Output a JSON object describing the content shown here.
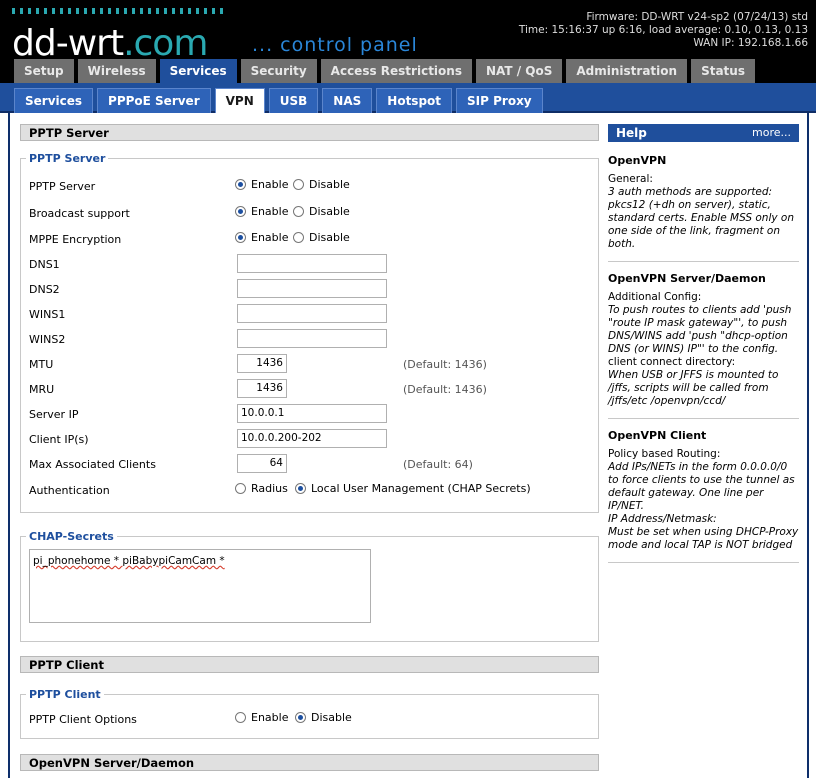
{
  "header": {
    "logo_text": "dd-wrt",
    "logo_suffix": ".com",
    "logo_sub": "... control panel",
    "firmware": "Firmware: DD-WRT v24-sp2 (07/24/13) std",
    "time": "Time: 15:16:37 up 6:16, load average: 0.10, 0.13, 0.13",
    "wan_ip": "WAN IP: 192.168.1.66"
  },
  "main_tabs": [
    "Setup",
    "Wireless",
    "Services",
    "Security",
    "Access Restrictions",
    "NAT / QoS",
    "Administration",
    "Status"
  ],
  "main_tab_active": "Services",
  "sub_tabs": [
    "Services",
    "PPPoE Server",
    "VPN",
    "USB",
    "NAS",
    "Hotspot",
    "SIP Proxy"
  ],
  "sub_tab_active": "VPN",
  "pptp_server": {
    "section_title": "PPTP Server",
    "fieldset_legend": "PPTP Server",
    "enable_label": "Enable",
    "disable_label": "Disable",
    "pptp_server_label": "PPTP Server",
    "pptp_server_value": "Enable",
    "broadcast_label": "Broadcast support",
    "broadcast_value": "Enable",
    "mppe_label": "MPPE Encryption",
    "mppe_value": "Enable",
    "dns1_label": "DNS1",
    "dns1_value": "",
    "dns2_label": "DNS2",
    "dns2_value": "",
    "wins1_label": "WINS1",
    "wins1_value": "",
    "wins2_label": "WINS2",
    "wins2_value": "",
    "mtu_label": "MTU",
    "mtu_value": "1436",
    "mtu_default": "(Default: 1436)",
    "mru_label": "MRU",
    "mru_value": "1436",
    "mru_default": "(Default: 1436)",
    "server_ip_label": "Server IP",
    "server_ip_value": "10.0.0.1",
    "client_ips_label": "Client IP(s)",
    "client_ips_value": "10.0.0.200-202",
    "max_clients_label": "Max Associated Clients",
    "max_clients_value": "64",
    "max_clients_default": "(Default: 64)",
    "auth_label": "Authentication",
    "auth_radius": "Radius",
    "auth_local": "Local User Management (CHAP Secrets)",
    "auth_value": "Local User Management (CHAP Secrets)"
  },
  "chap": {
    "legend": "CHAP-Secrets",
    "value": "pi_phonehome * piBabypiCamCam *"
  },
  "pptp_client": {
    "section_title": "PPTP Client",
    "fieldset_legend": "PPTP Client",
    "options_label": "PPTP Client Options",
    "enable_label": "Enable",
    "disable_label": "Disable",
    "value": "Disable"
  },
  "openvpn": {
    "section_title": "OpenVPN Server/Daemon"
  },
  "help": {
    "title": "Help",
    "more": "more...",
    "s1_title": "OpenVPN",
    "s1_p1": "General:",
    "s1_i1": "3 auth methods are supported: pkcs12 (+dh on server), static, standard certs. Enable MSS only on one side of the link, fragment on both.",
    "s2_title": "OpenVPN Server/Daemon",
    "s2_p1": "Additional Config:",
    "s2_i1": "To push routes to clients add 'push \"route IP mask gateway\"', to push DNS/WINS add 'push \"dhcp-option DNS (or WINS) IP\"' to the config.",
    "s2_p2": "client connect directory:",
    "s2_i2": "When USB or JFFS is mounted to /jffs, scripts will be called from /jffs/etc /openvpn/ccd/",
    "s3_title": "OpenVPN Client",
    "s3_p1": "Policy based Routing:",
    "s3_i1": "Add IPs/NETs in the form 0.0.0.0/0 to force clients to use the tunnel as default gateway. One line per IP/NET.",
    "s3_i2": "IP Address/Netmask:",
    "s3_i3": "Must be set when using DHCP-Proxy mode and local TAP is NOT bridged"
  }
}
